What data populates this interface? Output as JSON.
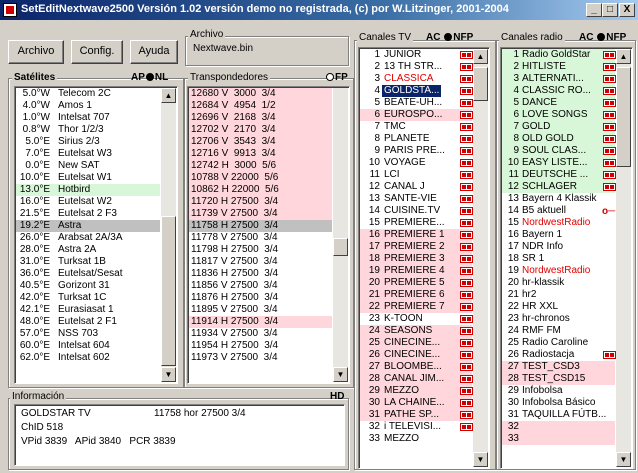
{
  "window": {
    "title": "SetEditNextwave2500 Versión  1.02  versión demo no registrada, (c) por W.Litzinger, 2001-2004",
    "minimize": "_",
    "maximize": "□",
    "close": "X"
  },
  "toolbar": {
    "archivo_label": "Archivo",
    "config_label": "Config.",
    "ayuda_label": "Ayuda"
  },
  "file": {
    "group_label": "Archivo",
    "filename": "Nextwave.bin"
  },
  "satellites": {
    "group_label": "Satélites",
    "mode_label_a": "AP",
    "mode_label_b": "NL",
    "items": [
      {
        "pos": "5.0°W",
        "name": "Telecom 2C"
      },
      {
        "pos": "4.0°W",
        "name": "Amos 1"
      },
      {
        "pos": "1.0°W",
        "name": "Intelsat 707"
      },
      {
        "pos": "0.8°W",
        "name": "Thor 1/2/3"
      },
      {
        "pos": "5.0°E",
        "name": "Sirius 2/3"
      },
      {
        "pos": "7.0°E",
        "name": "Eutelsat W3"
      },
      {
        "pos": "0.0°E",
        "name": "New SAT"
      },
      {
        "pos": "10.0°E",
        "name": "Eutelsat W1"
      },
      {
        "pos": "13.0°E",
        "name": "Hotbird"
      },
      {
        "pos": "16.0°E",
        "name": "Eutelsat W2"
      },
      {
        "pos": "21.5°E",
        "name": "Eutelsat 2 F3"
      },
      {
        "pos": "19.2°E",
        "name": "Astra"
      },
      {
        "pos": "26.0°E",
        "name": "Arabsat 2A/3A"
      },
      {
        "pos": "28.0°E",
        "name": "Astra 2A"
      },
      {
        "pos": "31.0°E",
        "name": "Turksat 1B"
      },
      {
        "pos": "36.0°E",
        "name": "Eutelsat/Sesat"
      },
      {
        "pos": "40.5°E",
        "name": "Gorizont 31"
      },
      {
        "pos": "42.0°E",
        "name": "Turksat 1C"
      },
      {
        "pos": "42.1°E",
        "name": "Eurasiasat 1"
      },
      {
        "pos": "48.0°E",
        "name": "Eutelsat 2 F1"
      },
      {
        "pos": "57.0°E",
        "name": "NSS 703"
      },
      {
        "pos": "60.0°E",
        "name": "Intelsat 604"
      },
      {
        "pos": "62.0°E",
        "name": "Intelsat 602"
      }
    ]
  },
  "transponders": {
    "group_label": "Transpondedores",
    "mode_label": "FP",
    "items": [
      "12680 V  3000  3/4",
      "12684 V  4954  1/2",
      "12696 V  2168  3/4",
      "12702 V  2170  3/4",
      "12706 V  3543  3/4",
      "12716 V  9913  3/4",
      "12742 H  3000  5/6",
      "10788 V 22000  5/6",
      "10862 H 22000  5/6",
      "11720 H 27500  3/4",
      "11739 V 27500  3/4",
      "11758 H 27500  3/4",
      "11778 V 27500  3/4",
      "11798 H 27500  3/4",
      "11817 V 27500  3/4",
      "11836 H 27500  3/4",
      "11856 V 27500  3/4",
      "11876 H 27500  3/4",
      "11895 V 27500  3/4",
      "11914 H 27500  3/4",
      "11934 V 27500  3/4",
      "11954 H 27500  3/4",
      "11973 V 27500  3/4"
    ]
  },
  "tv_channels": {
    "group_label": "Canales TV",
    "mode_label_a": "AC",
    "mode_label_b": "NFP",
    "items": [
      {
        "num": "1",
        "name": "JUNIOR"
      },
      {
        "num": "2",
        "name": "13 TH STR..."
      },
      {
        "num": "3",
        "name": "CLASSICA"
      },
      {
        "num": "4",
        "name": "GOLDSTA..."
      },
      {
        "num": "5",
        "name": "BEATE-UH..."
      },
      {
        "num": "6",
        "name": "EUROSPO..."
      },
      {
        "num": "7",
        "name": "TMC"
      },
      {
        "num": "8",
        "name": "PLANETE"
      },
      {
        "num": "9",
        "name": "PARIS PRE..."
      },
      {
        "num": "10",
        "name": "VOYAGE"
      },
      {
        "num": "11",
        "name": "LCI"
      },
      {
        "num": "12",
        "name": "CANAL J"
      },
      {
        "num": "13",
        "name": "SANTE-VIE"
      },
      {
        "num": "14",
        "name": "CUISINE.TV"
      },
      {
        "num": "15",
        "name": "PREMIERE..."
      },
      {
        "num": "16",
        "name": "PREMIERE 1"
      },
      {
        "num": "17",
        "name": "PREMIERE 2"
      },
      {
        "num": "18",
        "name": "PREMIERE 3"
      },
      {
        "num": "19",
        "name": "PREMIERE 4"
      },
      {
        "num": "20",
        "name": "PREMIERE 5"
      },
      {
        "num": "21",
        "name": "PREMIERE 6"
      },
      {
        "num": "22",
        "name": "PREMIERE 7"
      },
      {
        "num": "23",
        "name": "K-TOON"
      },
      {
        "num": "24",
        "name": "SEASONS"
      },
      {
        "num": "25",
        "name": "CINECINE..."
      },
      {
        "num": "26",
        "name": "CINECINE..."
      },
      {
        "num": "27",
        "name": "BLOOMBE..."
      },
      {
        "num": "28",
        "name": "CANAL JIM..."
      },
      {
        "num": "29",
        "name": "MEZZO"
      },
      {
        "num": "30",
        "name": "LA CHAINE..."
      },
      {
        "num": "31",
        "name": "PATHE SP..."
      },
      {
        "num": "32",
        "name": "i TELEVISI..."
      },
      {
        "num": "33",
        "name": "MEZZO"
      }
    ]
  },
  "radio_channels": {
    "group_label": "Canales radio",
    "mode_label_a": "AC",
    "mode_label_b": "NFP",
    "items": [
      {
        "num": "1",
        "name": "Radio GoldStar"
      },
      {
        "num": "2",
        "name": "HITLISTE"
      },
      {
        "num": "3",
        "name": "ALTERNATI..."
      },
      {
        "num": "4",
        "name": "CLASSIC RO..."
      },
      {
        "num": "5",
        "name": "DANCE"
      },
      {
        "num": "6",
        "name": "LOVE SONGS"
      },
      {
        "num": "7",
        "name": "GOLD"
      },
      {
        "num": "8",
        "name": "OLD GOLD"
      },
      {
        "num": "9",
        "name": "SOUL CLAS..."
      },
      {
        "num": "10",
        "name": "EASY LISTE..."
      },
      {
        "num": "11",
        "name": "DEUTSCHE ..."
      },
      {
        "num": "12",
        "name": "SCHLAGER"
      },
      {
        "num": "13",
        "name": "Bayern 4 Klassik"
      },
      {
        "num": "14",
        "name": "B5 aktuell"
      },
      {
        "num": "15",
        "name": "NordwestRadio"
      },
      {
        "num": "16",
        "name": "Bayern 1"
      },
      {
        "num": "17",
        "name": "NDR Info"
      },
      {
        "num": "18",
        "name": "SR 1"
      },
      {
        "num": "19",
        "name": "NordwestRadio"
      },
      {
        "num": "20",
        "name": "hr-klassik"
      },
      {
        "num": "21",
        "name": "hr2"
      },
      {
        "num": "22",
        "name": "HR XXL"
      },
      {
        "num": "23",
        "name": "hr-chronos"
      },
      {
        "num": "24",
        "name": "RMF FM"
      },
      {
        "num": "25",
        "name": "Radio Caroline"
      },
      {
        "num": "26",
        "name": "Radiostacja"
      },
      {
        "num": "27",
        "name": "TEST_CSD3"
      },
      {
        "num": "28",
        "name": "TEST_CSD15"
      },
      {
        "num": "29",
        "name": "Infobolsa"
      },
      {
        "num": "30",
        "name": "Infobolsa Básico"
      },
      {
        "num": "31",
        "name": "TAQUILLA FÚTB..."
      },
      {
        "num": "32",
        "name": ""
      },
      {
        "num": "33",
        "name": ""
      }
    ]
  },
  "info": {
    "group_label": "Información",
    "mode_label": "HD",
    "line1_name": "GOLDSTAR TV",
    "line1_tp": "11758 hor 27500 3/4",
    "line2": "ChID 518",
    "line3": "VPid 3839   APid 3840   PCR 3839"
  },
  "colors": {
    "pink": "#ffd6dc",
    "green": "#d8f7d8",
    "selected_blue": "#0a246a",
    "gray_selected": "#c0c0c0",
    "red_text": "#e00000"
  }
}
